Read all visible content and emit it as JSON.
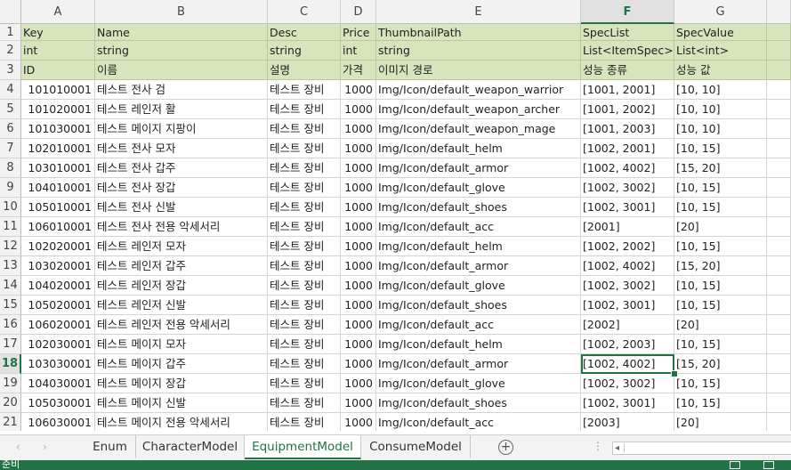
{
  "columns": [
    "A",
    "B",
    "C",
    "D",
    "E",
    "F",
    "G"
  ],
  "selected_column": "F",
  "selected_row": "18",
  "header_rows": [
    [
      "Key",
      "Name",
      "Desc",
      "Price",
      "ThumbnailPath",
      "SpecList",
      "SpecValue"
    ],
    [
      "int",
      "string",
      "string",
      "int",
      "string",
      "List<ItemSpec>",
      "List<int>"
    ],
    [
      "ID",
      "이름",
      "설명",
      "가격",
      "이미지 경로",
      "성능 종류",
      "성능 값"
    ]
  ],
  "data_rows": [
    [
      "101010001",
      "테스트 전사 검",
      "테스트 장비",
      "1000",
      "Img/Icon/default_weapon_warrior",
      "[1001, 2001]",
      "[10, 10]"
    ],
    [
      "101020001",
      "테스트 레인저 활",
      "테스트 장비",
      "1000",
      "Img/Icon/default_weapon_archer",
      "[1001, 2002]",
      "[10, 10]"
    ],
    [
      "101030001",
      "테스트 메이지 지팡이",
      "테스트 장비",
      "1000",
      "Img/Icon/default_weapon_mage",
      "[1001, 2003]",
      "[10, 10]"
    ],
    [
      "102010001",
      "테스트 전사 모자",
      "테스트 장비",
      "1000",
      "Img/Icon/default_helm",
      "[1002, 2001]",
      "[10, 15]"
    ],
    [
      "103010001",
      "테스트 전사 갑주",
      "테스트 장비",
      "1000",
      "Img/Icon/default_armor",
      "[1002, 4002]",
      "[15, 20]"
    ],
    [
      "104010001",
      "테스트 전사 장갑",
      "테스트 장비",
      "1000",
      "Img/Icon/default_glove",
      "[1002, 3002]",
      "[10, 15]"
    ],
    [
      "105010001",
      "테스트 전사 신발",
      "테스트 장비",
      "1000",
      "Img/Icon/default_shoes",
      "[1002, 3001]",
      "[10, 15]"
    ],
    [
      "106010001",
      "테스트 전사 전용 악세서리",
      "테스트 장비",
      "1000",
      "Img/Icon/default_acc",
      "[2001]",
      "[20]"
    ],
    [
      "102020001",
      "테스트 레인저 모자",
      "테스트 장비",
      "1000",
      "Img/Icon/default_helm",
      "[1002, 2002]",
      "[10, 15]"
    ],
    [
      "103020001",
      "테스트 레인저 갑주",
      "테스트 장비",
      "1000",
      "Img/Icon/default_armor",
      "[1002, 4002]",
      "[15, 20]"
    ],
    [
      "104020001",
      "테스트 레인저 장갑",
      "테스트 장비",
      "1000",
      "Img/Icon/default_glove",
      "[1002, 3002]",
      "[10, 15]"
    ],
    [
      "105020001",
      "테스트 레인저 신발",
      "테스트 장비",
      "1000",
      "Img/Icon/default_shoes",
      "[1002, 3001]",
      "[10, 15]"
    ],
    [
      "106020001",
      "테스트 레인저 전용 악세서리",
      "테스트 장비",
      "1000",
      "Img/Icon/default_acc",
      "[2002]",
      "[20]"
    ],
    [
      "102030001",
      "테스트 메이지 모자",
      "테스트 장비",
      "1000",
      "Img/Icon/default_helm",
      "[1002, 2003]",
      "[10, 15]"
    ],
    [
      "103030001",
      "테스트 메이지 갑주",
      "테스트 장비",
      "1000",
      "Img/Icon/default_armor",
      "[1002, 4002]",
      "[15, 20]"
    ],
    [
      "104030001",
      "테스트 메이지 장갑",
      "테스트 장비",
      "1000",
      "Img/Icon/default_glove",
      "[1002, 3002]",
      "[10, 15]"
    ],
    [
      "105030001",
      "테스트 메이지 신발",
      "테스트 장비",
      "1000",
      "Img/Icon/default_shoes",
      "[1002, 3001]",
      "[10, 15]"
    ],
    [
      "106030001",
      "테스트 메이지 전용 악세서리",
      "테스트 장비",
      "1000",
      "Img/Icon/default_acc",
      "[2003]",
      "[20]"
    ]
  ],
  "sheet_tabs": [
    {
      "label": "Enum",
      "active": false
    },
    {
      "label": "CharacterModel",
      "active": false
    },
    {
      "label": "EquipmentModel",
      "active": true
    },
    {
      "label": "ConsumeModel",
      "active": false
    }
  ],
  "tab_nav": {
    "prev_icon": "‹",
    "next_icon": "›",
    "more_icon": "⋮",
    "add_icon": "+"
  },
  "status": {
    "text": "준비"
  },
  "colors": {
    "accent": "#217346",
    "header_band": "#d7e4bc"
  }
}
